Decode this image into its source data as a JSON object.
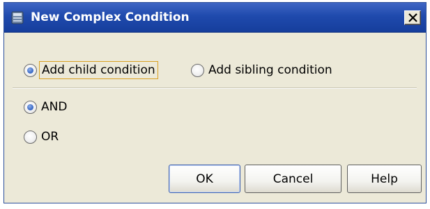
{
  "dialog": {
    "title": "New Complex Condition",
    "close_glyph": "✕",
    "icons": [
      "app-icon",
      "close-icon"
    ]
  },
  "position_options": [
    {
      "label": "Add child condition",
      "checked": true,
      "focused": true
    },
    {
      "label": "Add sibling condition",
      "checked": false,
      "focused": false
    }
  ],
  "operator_options": [
    {
      "label": "AND",
      "checked": true
    },
    {
      "label": "OR",
      "checked": false
    }
  ],
  "buttons": {
    "ok": "OK",
    "cancel": "Cancel",
    "help": "Help"
  },
  "colors": {
    "title_bar": "#1f4aad",
    "dialog_bg": "#ece9d8",
    "radio_selected": "#3d6cc8",
    "focus_border": "#d9a021"
  }
}
